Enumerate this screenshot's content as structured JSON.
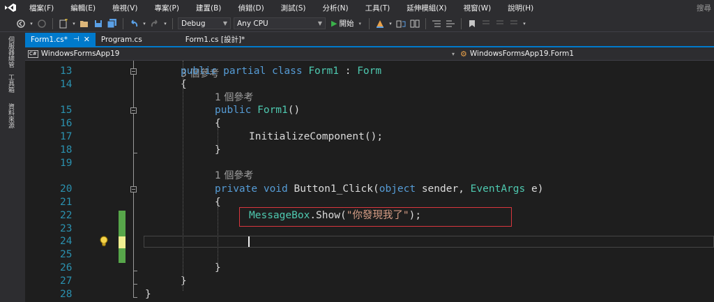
{
  "menu": {
    "items": [
      "檔案(F)",
      "編輯(E)",
      "檢視(V)",
      "專案(P)",
      "建置(B)",
      "偵錯(D)",
      "測試(S)",
      "分析(N)",
      "工具(T)",
      "延伸模組(X)",
      "視窗(W)",
      "說明(H)"
    ],
    "search_label": "搜尋"
  },
  "toolbar": {
    "configuration": "Debug",
    "platform": "Any CPU",
    "start_label": "開始"
  },
  "rail": {
    "items": [
      "伺服器總管",
      "工具箱",
      "資料來源"
    ]
  },
  "tabs": [
    {
      "label": "Form1.cs*",
      "active": true
    },
    {
      "label": "Program.cs",
      "active": false
    },
    {
      "label": "Form1.cs [設計]*",
      "active": false
    }
  ],
  "navbar": {
    "project": "WindowsFormsApp19",
    "cs_badge": "C#",
    "class": "WindowsFormsApp19.Form1"
  },
  "editor": {
    "top_ref_partial": "3 個參考",
    "lines": [
      {
        "n": "13",
        "parts": [
          [
            "kw",
            "public partial class "
          ],
          [
            "type",
            "Form1"
          ],
          [
            "plain",
            " : "
          ],
          [
            "type",
            "Form"
          ]
        ]
      },
      {
        "n": "14",
        "parts": [
          [
            "plain",
            "{"
          ]
        ]
      },
      {
        "n": "",
        "ref": "1 個參考"
      },
      {
        "n": "15",
        "parts": [
          [
            "kw",
            "public "
          ],
          [
            "type",
            "Form1"
          ],
          [
            "plain",
            "()"
          ]
        ]
      },
      {
        "n": "16",
        "parts": [
          [
            "plain",
            "{"
          ]
        ]
      },
      {
        "n": "17",
        "parts": [
          [
            "plain",
            "InitializeComponent();"
          ]
        ]
      },
      {
        "n": "18",
        "parts": [
          [
            "plain",
            "}"
          ]
        ]
      },
      {
        "n": "19",
        "parts": []
      },
      {
        "n": "",
        "ref": "1 個參考"
      },
      {
        "n": "20",
        "parts": [
          [
            "kw",
            "private void "
          ],
          [
            "plain",
            "Button1_Click("
          ],
          [
            "kw",
            "object "
          ],
          [
            "plain",
            "sender, "
          ],
          [
            "type",
            "EventArgs "
          ],
          [
            "plain",
            "e)"
          ]
        ]
      },
      {
        "n": "21",
        "parts": [
          [
            "plain",
            "{"
          ]
        ]
      },
      {
        "n": "22",
        "parts": [
          [
            "type",
            "MessageBox"
          ],
          [
            "plain",
            ".Show("
          ],
          [
            "str",
            "\"你發現我了\""
          ],
          [
            "plain",
            ");"
          ]
        ]
      },
      {
        "n": "23",
        "parts": []
      },
      {
        "n": "24",
        "parts": []
      },
      {
        "n": "25",
        "parts": []
      },
      {
        "n": "26",
        "parts": [
          [
            "plain",
            "}"
          ]
        ]
      },
      {
        "n": "27",
        "parts": [
          [
            "plain",
            "}"
          ]
        ]
      },
      {
        "n": "28",
        "parts": [
          [
            "plain",
            "}"
          ]
        ]
      }
    ]
  }
}
